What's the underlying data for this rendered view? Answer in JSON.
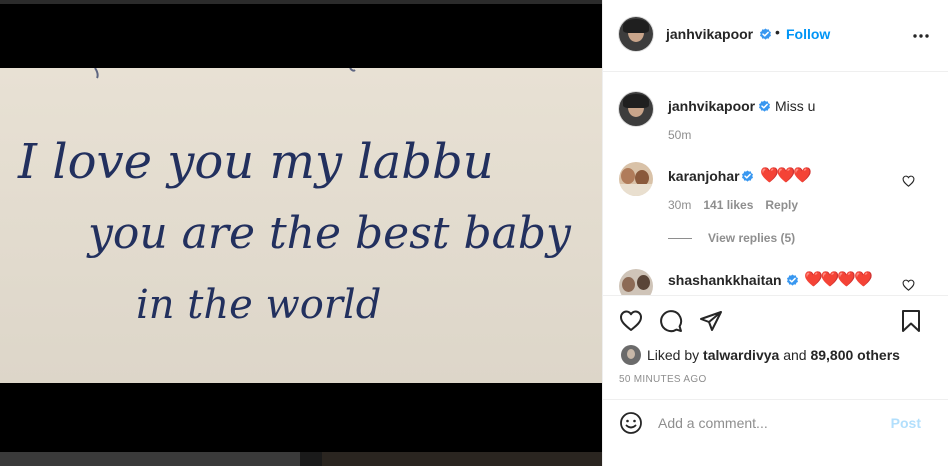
{
  "post": {
    "author": "janhvikapoor",
    "follow_label": "Follow",
    "separator": "•",
    "caption": {
      "username": "janhvikapoor",
      "text": "Miss u",
      "time": "50m"
    },
    "note_lines": [
      "I love you my labbu",
      "you are the best baby",
      "in the world"
    ]
  },
  "comments": [
    {
      "username": "karanjohar",
      "text": "❤️❤️❤️",
      "time": "30m",
      "likes": "141 likes",
      "reply_label": "Reply",
      "view_replies": "View replies (5)"
    },
    {
      "username": "shashankkhaitan",
      "text": "❤️❤️❤️❤️"
    }
  ],
  "likes": {
    "prefix": "Liked by",
    "user": "talwardivya",
    "conj": "and",
    "others": "89,800 others"
  },
  "timestamp": "50 MINUTES AGO",
  "composer": {
    "placeholder": "Add a comment...",
    "post_label": "Post"
  },
  "icons": {
    "more": "more-options-icon",
    "verified": "verified-badge-icon",
    "like": "heart-icon",
    "comment": "comment-icon",
    "share": "paper-plane-icon",
    "save": "bookmark-icon",
    "emoji": "smiley-icon"
  },
  "colors": {
    "link_blue": "#0095f6",
    "post_disabled": "#b2dffc",
    "heart_red": "#e0245e",
    "muted": "#8e8e8e"
  }
}
